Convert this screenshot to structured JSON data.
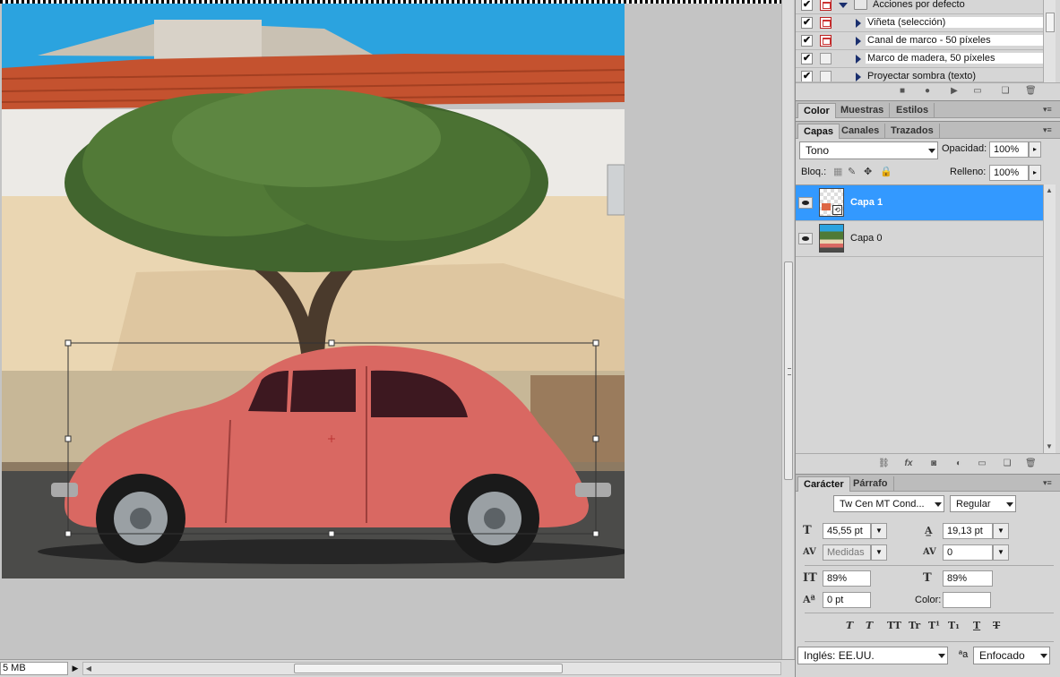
{
  "status_bar": {
    "doc_size": "5 MB"
  },
  "actions_panel": {
    "rows": [
      {
        "label": "Acciones por defecto",
        "checked": "✔"
      },
      {
        "label": "Viñeta (selección)",
        "checked": "✔"
      },
      {
        "label": "Canal de marco - 50 píxeles",
        "checked": "✔"
      },
      {
        "label": "Marco de madera, 50 píxeles",
        "checked": "✔"
      },
      {
        "label": "Proyectar sombra (texto)",
        "checked": "✔"
      }
    ]
  },
  "color_panel": {
    "tabs": [
      "Color",
      "Muestras",
      "Estilos"
    ]
  },
  "layers_panel": {
    "tabs": [
      "Capas",
      "Canales",
      "Trazados"
    ],
    "blend_mode": "Tono",
    "opacity_label": "Opacidad:",
    "opacity_value": "100%",
    "lock_label": "Bloq.:",
    "fill_label": "Relleno:",
    "fill_value": "100%",
    "layers": [
      {
        "name": "Capa 1",
        "selected": true
      },
      {
        "name": "Capa 0",
        "selected": false
      }
    ],
    "footer_icons": [
      "link-icon",
      "fx-icon",
      "mask-icon",
      "adjustment-icon",
      "group-icon",
      "new-layer-icon",
      "trash-icon"
    ]
  },
  "character_panel": {
    "tabs": [
      "Carácter",
      "Párrafo"
    ],
    "font_family": "Tw Cen MT Cond...",
    "font_style": "Regular",
    "font_size": "45,55 pt",
    "leading": "19,13 pt",
    "kerning": "Medidas",
    "tracking": "0",
    "vertical_scale": "89%",
    "horizontal_scale": "89%",
    "baseline_shift": "0 pt",
    "color_label": "Color:",
    "language": "Inglés: EE.UU.",
    "antialias_icon_text": "ªa",
    "antialias": "Enfocado",
    "style_buttons": [
      "T",
      "T",
      "TT",
      "Tr",
      "T¹",
      "T₁",
      "T",
      "T"
    ]
  },
  "colors": {
    "selection_blue": "#3399ff",
    "panel_bg": "#d6d6d6",
    "canvas_bg": "#c4c4c4"
  }
}
